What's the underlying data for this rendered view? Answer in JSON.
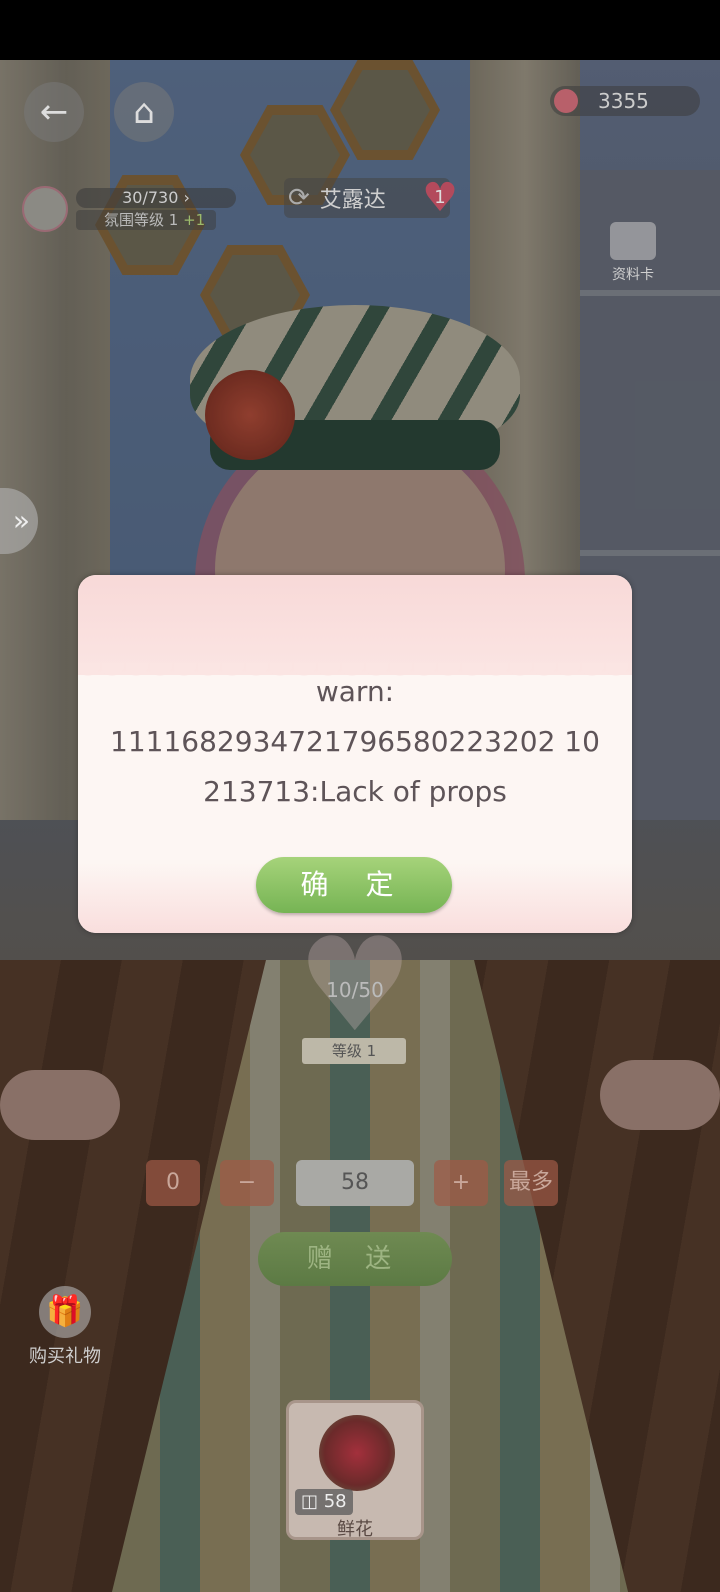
{
  "top_bar": {
    "back_icon": "back-arrow-icon",
    "home_icon": "home-icon",
    "currency_value": "3355"
  },
  "mood": {
    "progress_text": "30/730",
    "level_label": "氛围等级 1",
    "level_bonus": "+1"
  },
  "character": {
    "name": "艾露达",
    "heart_count": "1"
  },
  "profile_card_label": "资料卡",
  "dialog": {
    "line1": "warn:",
    "line2": "1111682934721796580223202 10",
    "line3": "213713:Lack of props",
    "confirm_label": "确 定"
  },
  "favor": {
    "value_text": "10/50",
    "level_label": "等级 1"
  },
  "quantity": {
    "min_label": "0",
    "minus_label": "−",
    "value": "58",
    "plus_label": "+",
    "max_label": "最多"
  },
  "send_label": "赠 送",
  "buy_gift_label": "购买礼物",
  "gift_item": {
    "count": "58",
    "name": "鲜花"
  },
  "colors": {
    "confirm_button": "#86c35f",
    "dialog_bg": "#fdf6f3",
    "dialog_text": "#5e5458"
  }
}
